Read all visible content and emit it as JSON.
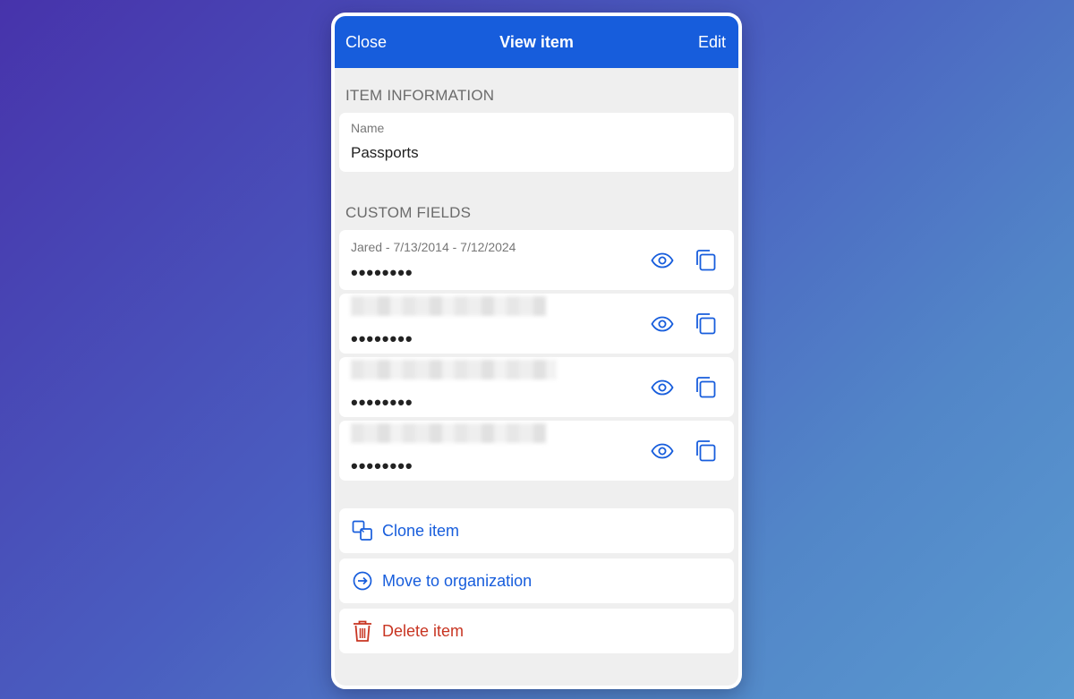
{
  "header": {
    "close_label": "Close",
    "title": "View item",
    "edit_label": "Edit"
  },
  "item_information": {
    "section_title": "ITEM INFORMATION",
    "name_label": "Name",
    "name_value": "Passports"
  },
  "custom_fields": {
    "section_title": "CUSTOM FIELDS",
    "fields": [
      {
        "label": "Jared - 7/13/2014 - 7/12/2024",
        "value": "••••••••",
        "label_redacted": false
      },
      {
        "label": "",
        "value": "••••••••",
        "label_redacted": true
      },
      {
        "label": "",
        "value": "••••••••",
        "label_redacted": true
      },
      {
        "label": "",
        "value": "••••••••",
        "label_redacted": true
      }
    ]
  },
  "actions": {
    "clone_label": "Clone item",
    "move_label": "Move to organization",
    "delete_label": "Delete item"
  },
  "icons": {
    "toggle_visibility": "eye-icon",
    "copy": "copy-icon",
    "clone": "clone-icon",
    "move": "arrow-circle-right-icon",
    "delete": "trash-icon"
  },
  "colors": {
    "accent": "#175ddc",
    "danger": "#c83522",
    "background": "#efefef"
  }
}
